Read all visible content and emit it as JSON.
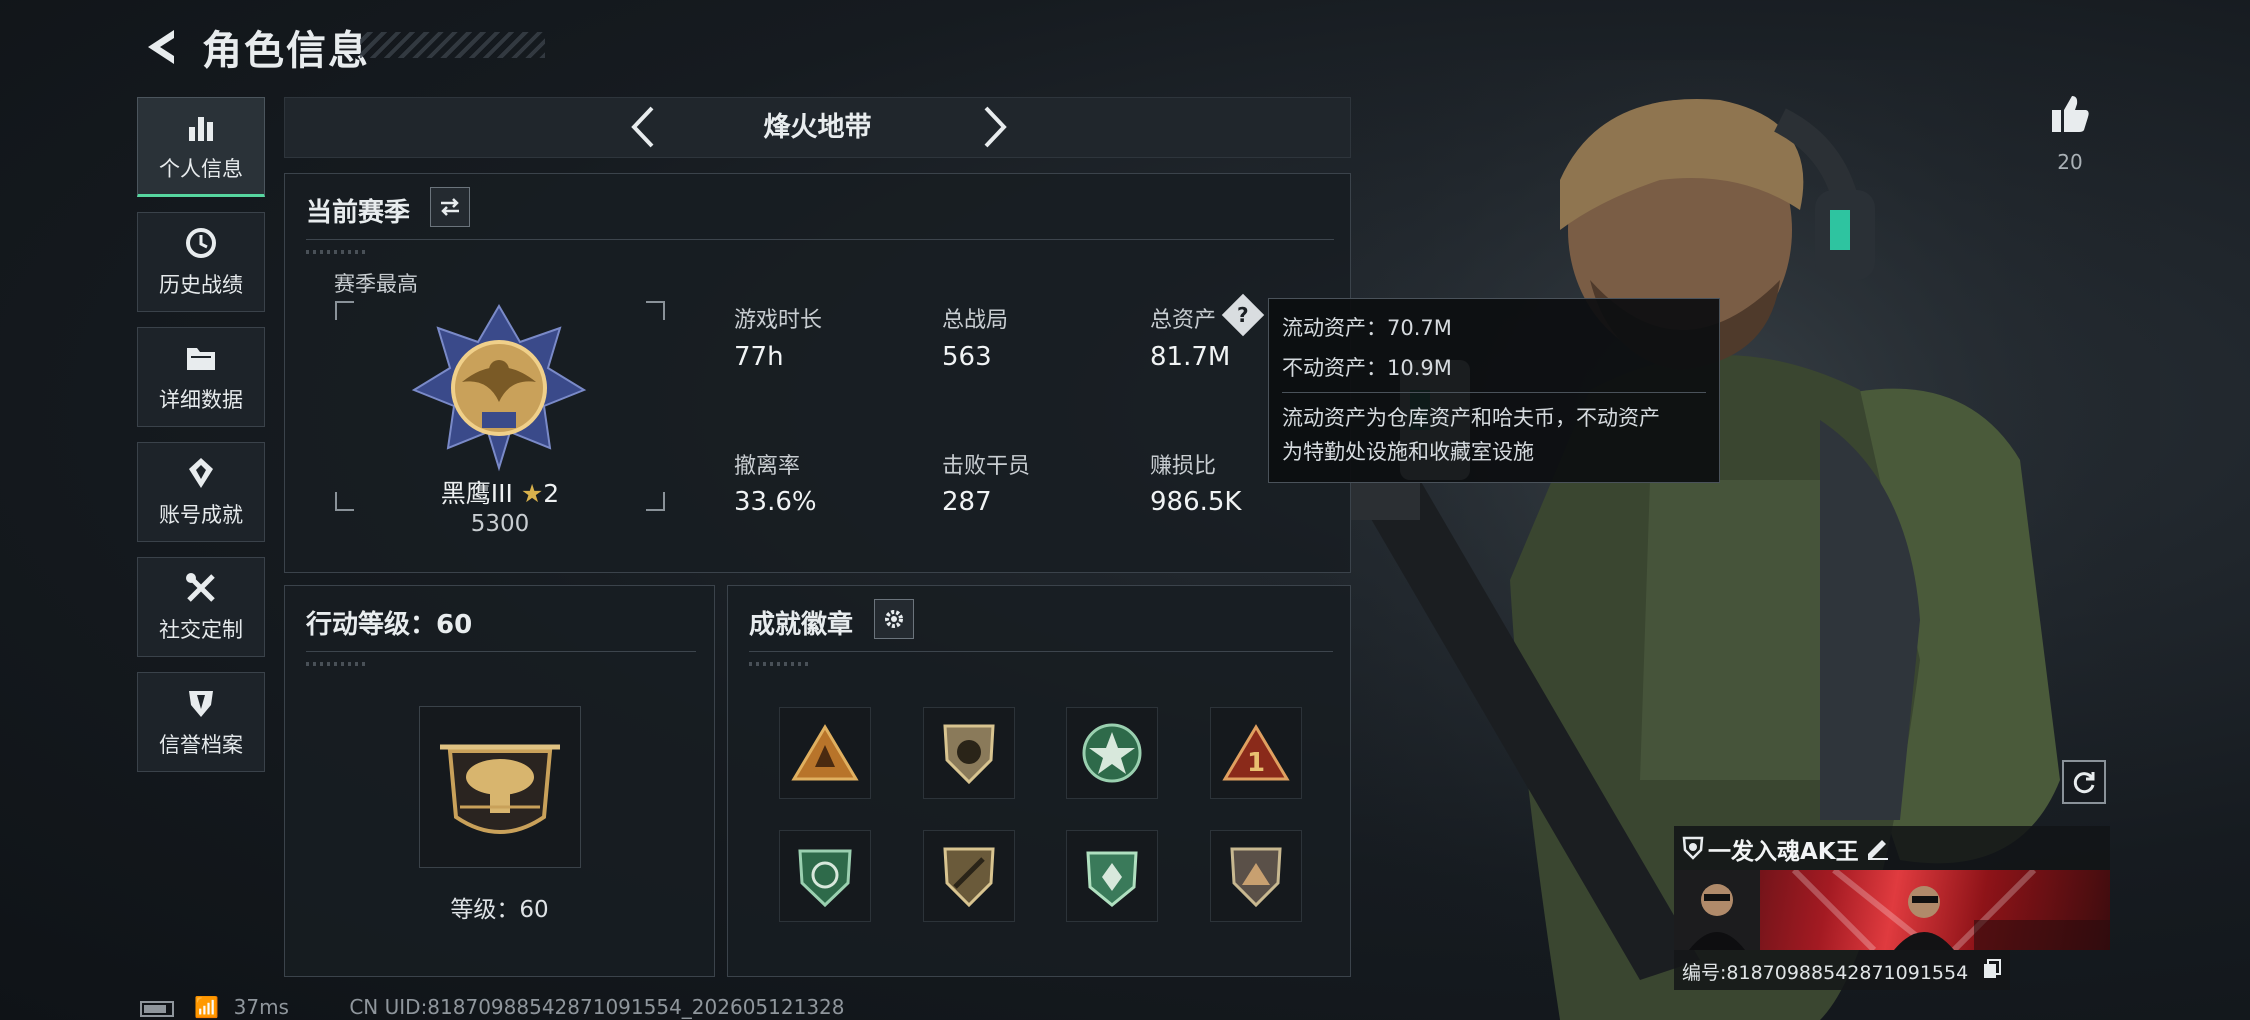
{
  "header": {
    "title": "角色信息"
  },
  "sidebar": {
    "items": [
      {
        "label": "个人信息",
        "icon": "bar-chart-icon",
        "active": true
      },
      {
        "label": "历史战绩",
        "icon": "history-icon",
        "active": false
      },
      {
        "label": "详细数据",
        "icon": "folder-icon",
        "active": false
      },
      {
        "label": "账号成就",
        "icon": "achievement-icon",
        "active": false
      },
      {
        "label": "社交定制",
        "icon": "tools-icon",
        "active": false
      },
      {
        "label": "信誉档案",
        "icon": "shield-icon",
        "active": false
      }
    ]
  },
  "mode": {
    "title": "烽火地带"
  },
  "season": {
    "title": "当前赛季",
    "best_label": "赛季最高",
    "rank_name": "黑鹰III",
    "rank_stars": "2",
    "rank_score": "5300",
    "stats": [
      {
        "label": "游戏时长",
        "value": "77h"
      },
      {
        "label": "总战局",
        "value": "563"
      },
      {
        "label": "总资产",
        "value": "81.7M"
      },
      {
        "label": "撤离率",
        "value": "33.6%"
      },
      {
        "label": "击败干员",
        "value": "287"
      },
      {
        "label": "赚损比",
        "value": "986.5K"
      }
    ]
  },
  "tooltip": {
    "line1": "流动资产：70.7M",
    "line2": "不动资产：10.9M",
    "desc1": "流动资产为仓库资产和哈夫币，不动资产",
    "desc2": "为特勤处设施和收藏室设施"
  },
  "action_level": {
    "title": "行动等级：60",
    "level_label": "等级：60"
  },
  "badges": {
    "title": "成就徽章",
    "count": 8
  },
  "likes": {
    "count": "20"
  },
  "player": {
    "name": "一发入魂AK王",
    "uid": "编号:81870988542871091554"
  },
  "status": {
    "ping": "37ms",
    "uid_line": "CN UID:81870988542871091554_202605121328"
  },
  "colors": {
    "accent": "#57d6a0",
    "gold": "#c9a15a"
  }
}
